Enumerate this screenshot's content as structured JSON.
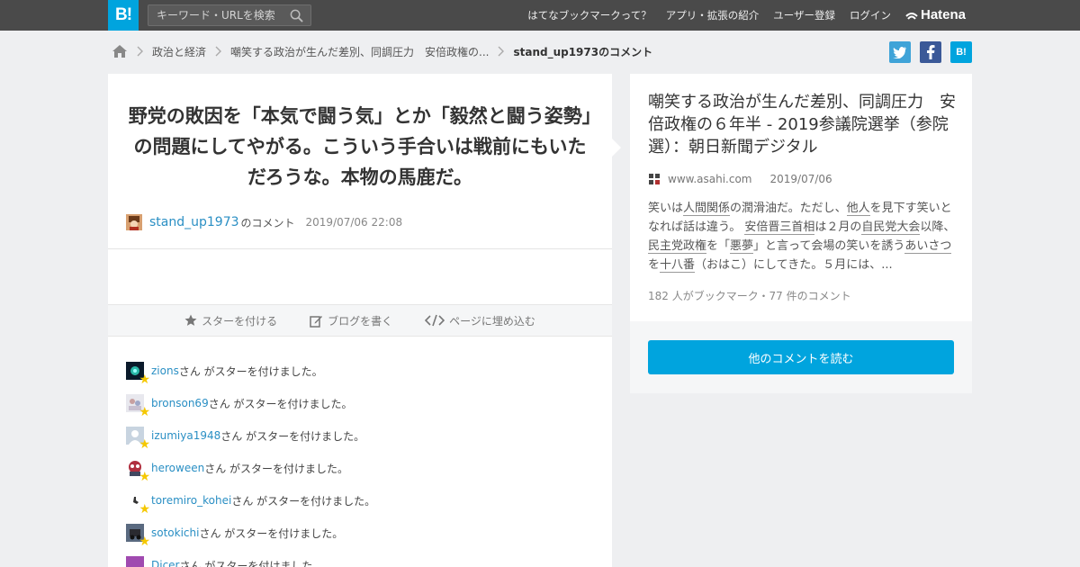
{
  "topbar": {
    "logo": "B!",
    "search_placeholder": "キーワード・URLを検索",
    "nav": [
      "はてなブックマークって？",
      "アプリ・拡張の紹介",
      "ユーザー登録",
      "ログイン"
    ],
    "brand": "Hatena"
  },
  "breadcrumb": {
    "items": [
      "政治と経済",
      "嘲笑する政治が生んだ差別、同調圧力　安倍政権の..."
    ],
    "current": "stand_up1973のコメント"
  },
  "share": {
    "hatena_label": "B!"
  },
  "comment": {
    "text": "野党の敗因を「本気で闘う気」とか「毅然と闘う姿勢」の問題にしてやがる。こういう手合いは戦前にもいただろうな。本物の馬鹿だ。",
    "username": "stand_up1973",
    "suffix": "のコメント",
    "date": "2019/07/06 22:08"
  },
  "actions": {
    "star": "スターを付ける",
    "blog": "ブログを書く",
    "embed": "ページに埋め込む"
  },
  "stars": {
    "suffix": "さん がスターを付けました。",
    "users": [
      "zions",
      "bronson69",
      "izumiya1948",
      "heroween",
      "toremiro_kohei",
      "sotokichi",
      "Dicer"
    ]
  },
  "entry": {
    "title": "嘲笑する政治が生んだ差別、同調圧力　安倍政権の６年半 - 2019参議院選挙（参院選）：朝日新聞デジタル",
    "domain": "www.asahi.com",
    "date": "2019/07/06",
    "excerpt": {
      "p1": "笑いは",
      "kw1": "人間関係",
      "p2": "の潤滑油だ。ただし、",
      "kw2": "他人",
      "p3": "を見下す笑いとなれば話は違う。",
      "kw3": "安倍晋三首相",
      "p4": "は２月の",
      "kw4": "自民党大会",
      "p5": "以降、",
      "kw5": "民主党政権",
      "p6": "を「",
      "kw6": "悪夢",
      "p7": "」と言って会場の笑いを誘う",
      "kw7": "あいさつ",
      "p8": "を",
      "kw8": "十八番",
      "p9": "（おはこ）にしてきた。５月には、..."
    },
    "counts": "182 人がブックマーク・77 件のコメント",
    "read_more": "他のコメントを読む"
  },
  "colors": {
    "accent": "#00a4de",
    "link": "#2a8fc4",
    "topbar": "#4a4a4a",
    "star": "#f5c800"
  }
}
